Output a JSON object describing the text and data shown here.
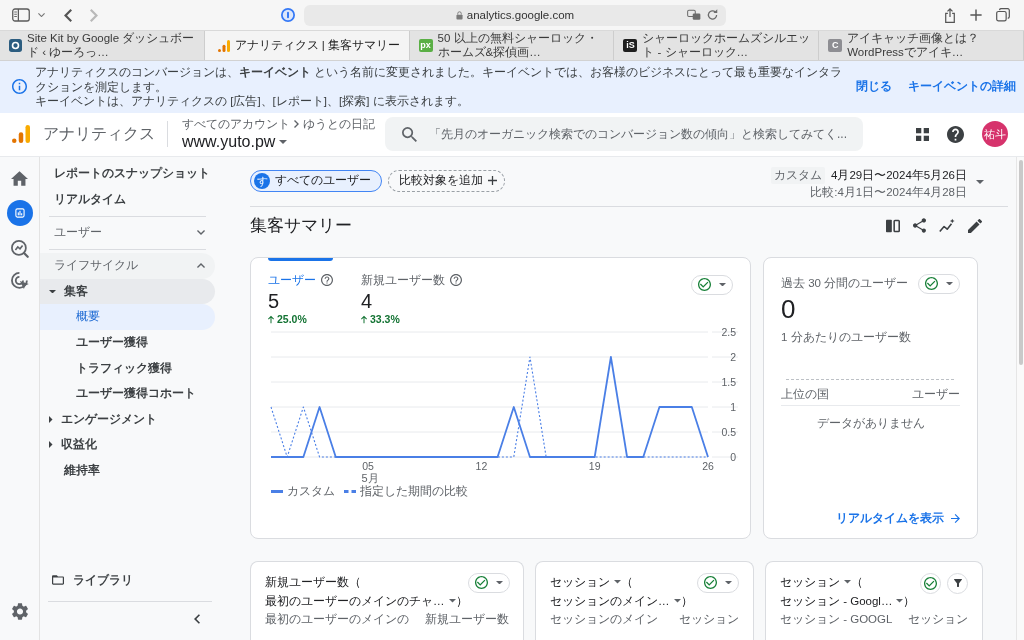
{
  "browser": {
    "url": "analytics.google.com",
    "tabs": [
      {
        "title": "Site Kit by Google ダッシュボード ‹ ゆーろっ…",
        "selected": false,
        "kind": "sitekit"
      },
      {
        "title": "アナリティクス | 集客サマリー",
        "selected": true,
        "kind": "analytics"
      },
      {
        "title": "50 以上の無料シャーロック・ホームズ&探偵画…",
        "selected": false,
        "kind": "tile",
        "icon_text": "px",
        "color": "#5aaf45"
      },
      {
        "title": "シャーロックホームズシルエット - シャーロック…",
        "selected": false,
        "kind": "tile",
        "icon_text": "iS",
        "color": "#1f1f1f"
      },
      {
        "title": "アイキャッチ画像とは？ WordPressでアイキ…",
        "selected": false,
        "kind": "tile",
        "icon_text": "C",
        "color": "#8e8e93"
      }
    ]
  },
  "banner": {
    "lines": [
      "アナリティクスのコンバージョンは、**キーイベント** という名前に変更されました。キーイベントでは、お客様のビジネスにとって最も重要なインタラクションを測定します。",
      "キーイベントは、アナリティクスの [広告]、[レポート]、[探索] に表示されます。"
    ],
    "actions": [
      "閉じる",
      "キーイベントの詳細"
    ]
  },
  "header": {
    "product": "アナリティクス",
    "breadcrumb": [
      "すべてのアカウント",
      "ゆうとの日記"
    ],
    "property": "www.yuto.pw",
    "search": {
      "placeholder": "「先月のオーガニック検索でのコンバージョン数の傾向」と検索してみてく..."
    },
    "avatar": "祐斗"
  },
  "rail": [
    {
      "kind": "home",
      "selected": false
    },
    {
      "kind": "reports",
      "selected": true
    },
    {
      "kind": "explore",
      "selected": false
    },
    {
      "kind": "advertising",
      "selected": false
    }
  ],
  "sidebar": {
    "items": [
      {
        "label": "レポートのスナップショット",
        "selected": false
      },
      {
        "label": "リアルタイム",
        "selected": false
      }
    ],
    "sections": [
      {
        "title": "ユーザー",
        "expanded": false
      },
      {
        "title": "ライフサイクル",
        "expanded": true,
        "items": [
          {
            "label": "集客",
            "kind": "group",
            "expanded": true,
            "children": [
              {
                "label": "概要",
                "selected": true
              },
              {
                "label": "ユーザー獲得",
                "selected": false
              },
              {
                "label": "トラフィック獲得",
                "selected": false
              },
              {
                "label": "ユーザー獲得コホート",
                "selected": false
              }
            ]
          },
          {
            "label": "エンゲージメント",
            "kind": "group",
            "expanded": false
          },
          {
            "label": "収益化",
            "kind": "group",
            "expanded": false
          },
          {
            "label": "維持率",
            "kind": "link",
            "selected": false
          }
        ]
      }
    ],
    "library": "ライブラリ"
  },
  "filters": {
    "segments": [
      {
        "avatar": "す",
        "label": "すべてのユーザー",
        "selected": true
      }
    ],
    "add_comparison": "比較対象を追加"
  },
  "date_range": {
    "preset": "カスタム",
    "range": "4月29日〜2024年5月26日",
    "comparison": "比較:4月1日〜2024年4月28日"
  },
  "page_title": "集客サマリー",
  "overview_card": {
    "metrics": [
      {
        "label": "ユーザー",
        "value": "5",
        "change": "25.0%",
        "selected": true
      },
      {
        "label": "新規ユーザー数",
        "value": "4",
        "change": "33.3%",
        "selected": false
      }
    ],
    "actions": [
      {
        "kind": "check-menu"
      }
    ],
    "chart_data": {
      "type": "line",
      "categories": [
        null,
        null,
        null,
        null,
        null,
        null,
        "05",
        null,
        null,
        null,
        null,
        null,
        null,
        "12",
        null,
        null,
        null,
        null,
        null,
        null,
        "19",
        null,
        null,
        null,
        null,
        null,
        null,
        "26"
      ],
      "ylim": [
        0,
        2.5
      ],
      "yticks": [
        0,
        0.5,
        1,
        1.5,
        2,
        2.5
      ],
      "grid": true,
      "annotations": [
        "5月"
      ],
      "series": [
        {
          "name": "カスタム",
          "color": "#4a7fe6",
          "line_style": "solid",
          "values": [
            0,
            0,
            0,
            1,
            0,
            0,
            0,
            0,
            0,
            0,
            0,
            0,
            0,
            0,
            0,
            1,
            0,
            0,
            0,
            0,
            0,
            2,
            0,
            0,
            1,
            1,
            1,
            0
          ]
        },
        {
          "name": "指定した期間の比較",
          "color": "#4a7fe6",
          "line_style": "dashed",
          "values": [
            1,
            0,
            1,
            0,
            0,
            0,
            0,
            0,
            0,
            0,
            0,
            0,
            0,
            0,
            0,
            0,
            2,
            0,
            0,
            0,
            0,
            0,
            0,
            0,
            0,
            0,
            0,
            0
          ]
        }
      ]
    }
  },
  "realtime_card": {
    "title": "過去 30 分間のユーザー",
    "value": "0",
    "actions": [
      {
        "kind": "check-menu"
      }
    ],
    "subtitle": "1 分あたりのユーザー数",
    "columns": [
      "上位の国",
      "ユーザー"
    ],
    "empty_message": "データがありません",
    "link": "リアルタイムを表示"
  },
  "report_cards": [
    {
      "title_lines": [
        [
          {
            "text": "新規ユーザー数（",
            "menu": false
          }
        ],
        [
          {
            "text": "最初のユーザーのメインのチャ…",
            "menu": true
          },
          {
            "text": "）",
            "menu": false
          }
        ]
      ],
      "actions": [
        {
          "kind": "check-menu"
        }
      ],
      "columns": [
        "最初のユーザーのメインの",
        "新規ユーザー数"
      ]
    },
    {
      "title_lines": [
        [
          {
            "text": "セッション",
            "menu": true
          },
          {
            "text": "（",
            "menu": false
          }
        ],
        [
          {
            "text": "セッションのメイン…",
            "menu": true
          },
          {
            "text": "）",
            "menu": false
          }
        ]
      ],
      "actions": [
        {
          "kind": "check-menu"
        }
      ],
      "columns": [
        "セッションのメイン",
        "セッション"
      ]
    },
    {
      "title_lines": [
        [
          {
            "text": "セッション",
            "menu": true
          },
          {
            "text": "（",
            "menu": false
          }
        ],
        [
          {
            "text": "セッション - Googl…",
            "menu": true
          },
          {
            "text": "）",
            "menu": false
          }
        ]
      ],
      "actions": [
        {
          "kind": "check"
        },
        {
          "kind": "filter"
        }
      ],
      "columns": [
        "セッション - GOOGL",
        "セッション"
      ]
    }
  ]
}
